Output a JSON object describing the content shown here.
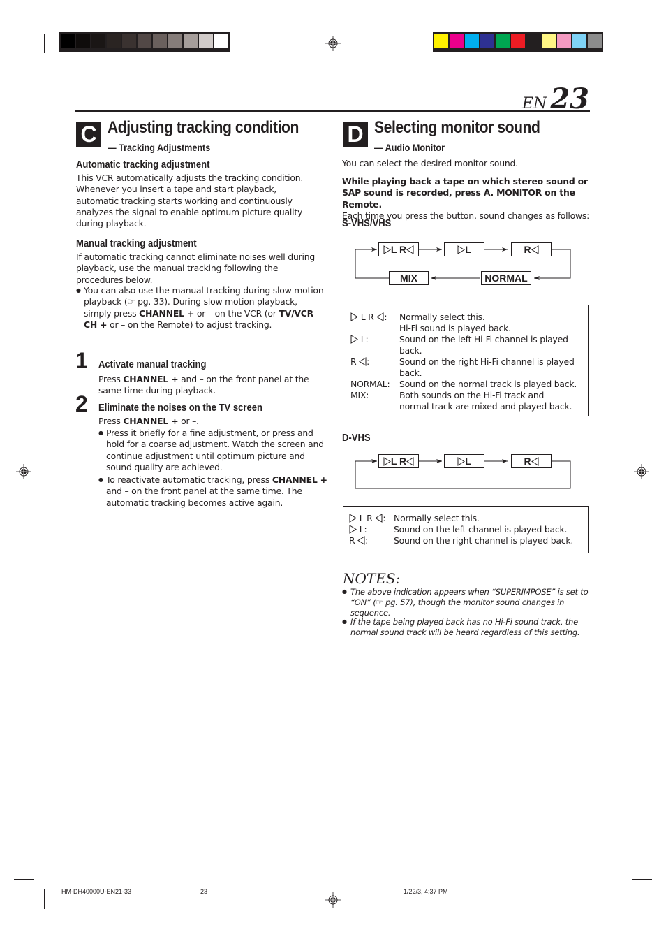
{
  "print_marks": {
    "gray_bar": [
      "#000000",
      "#0f0c0b",
      "#1a1615",
      "#2a2422",
      "#3a3230",
      "#524846",
      "#6a605d",
      "#867d7a",
      "#a69e9b",
      "#d1cbc9",
      "#ffffff"
    ],
    "color_bar": [
      "#fff200",
      "#ec008c",
      "#00aeef",
      "#2e3192",
      "#00a651",
      "#ed1c24",
      "#231f20",
      "#fff685",
      "#f49ac1",
      "#7fd3f7",
      "#8c8c8c"
    ]
  },
  "header": {
    "lang": "EN",
    "page_number": "23"
  },
  "section_c": {
    "badge": "C",
    "title": "Adjusting tracking condition",
    "subtitle": "— Tracking Adjustments",
    "auto_heading": "Automatic tracking adjustment",
    "auto_body": "This VCR automatically adjusts the tracking condition. Whenever you insert a tape and start playback, automatic tracking starts working and continuously analyzes the signal to enable optimum picture quality during playback.",
    "manual_heading": "Manual tracking adjustment",
    "manual_body": "If automatic tracking cannot eliminate noises well during playback, use the manual tracking following the procedures below.",
    "manual_bullet": {
      "t1": "You can also use the manual tracking during slow motion playback (☞ pg. 33). During slow motion playback, simply press ",
      "b1": "CHANNEL +",
      "t2": " or – on the VCR (or ",
      "b2": "TV/VCR CH +",
      "t3": " or – on the Remote) to adjust tracking."
    },
    "steps": [
      {
        "number": "1",
        "title": "Activate manual tracking",
        "t1": "Press ",
        "b1": "CHANNEL +",
        "t2": " and – on the front panel at the same time during playback."
      },
      {
        "number": "2",
        "title": "Eliminate the noises on the TV screen",
        "t1": "Press ",
        "b1": "CHANNEL +",
        "t2": " or –.",
        "bullet1": "Press it briefly for a fine adjustment, or press and hold for a coarse adjustment. Watch the screen and continue adjustment until optimum picture and sound quality are achieved.",
        "bullet2_t1": "To reactivate automatic tracking, press ",
        "bullet2_b1": "CHANNEL +",
        "bullet2_t2": " and – on the front panel at the same time. The automatic tracking becomes active again."
      }
    ]
  },
  "section_d": {
    "badge": "D",
    "title": "Selecting monitor sound",
    "subtitle": "— Audio Monitor",
    "intro": "You can select the desired monitor sound.",
    "instruction_bold": "While playing back a tape on which stereo sound or SAP sound is recorded, press A. MONITOR on the Remote.",
    "instruction_rest": "Each time you press the button, sound changes as follows:",
    "svhs": {
      "heading": "S-VHS/VHS",
      "nodes": [
        "L R",
        "L",
        "R",
        "NORMAL",
        "MIX"
      ],
      "legend": [
        {
          "key": "L R",
          "sep": ":",
          "lines": [
            "Normally select this.",
            "Hi-Fi sound is played back."
          ]
        },
        {
          "key": "L",
          "sep": ":",
          "lines": [
            "Sound on the left Hi-Fi channel is played",
            "back."
          ]
        },
        {
          "key": "R",
          "sep": ":",
          "lines": [
            "Sound on the right Hi-Fi channel is played",
            "back."
          ]
        },
        {
          "key": "NORMAL",
          "sep": ":",
          "lines": [
            "Sound on the normal track is played back."
          ]
        },
        {
          "key": "MIX",
          "sep": ":",
          "lines": [
            "Both sounds on the Hi-Fi track and",
            "normal track are mixed and played back."
          ]
        }
      ]
    },
    "dvhs": {
      "heading": "D-VHS",
      "nodes": [
        "L R",
        "L",
        "R"
      ],
      "legend": [
        {
          "key": "L R",
          "sep": ":",
          "lines": [
            "Normally select this."
          ]
        },
        {
          "key": "L",
          "sep": ":",
          "lines": [
            "Sound on the left channel is played back."
          ]
        },
        {
          "key": "R",
          "sep": ":",
          "lines": [
            "Sound on the right channel is played back."
          ]
        }
      ]
    },
    "notes": {
      "title": "NOTES:",
      "items": [
        "The above indication appears when “SUPERIMPOSE” is set to “ON” (☞ pg. 57), though the monitor sound changes in sequence.",
        "If the tape being played back has no Hi-Fi sound track, the normal sound track will be heard regardless of this setting."
      ]
    }
  },
  "footer": {
    "doc_code": "HM-DH40000U-EN21-33",
    "page": "23",
    "timestamp": "1/22/3, 4:37 PM"
  }
}
